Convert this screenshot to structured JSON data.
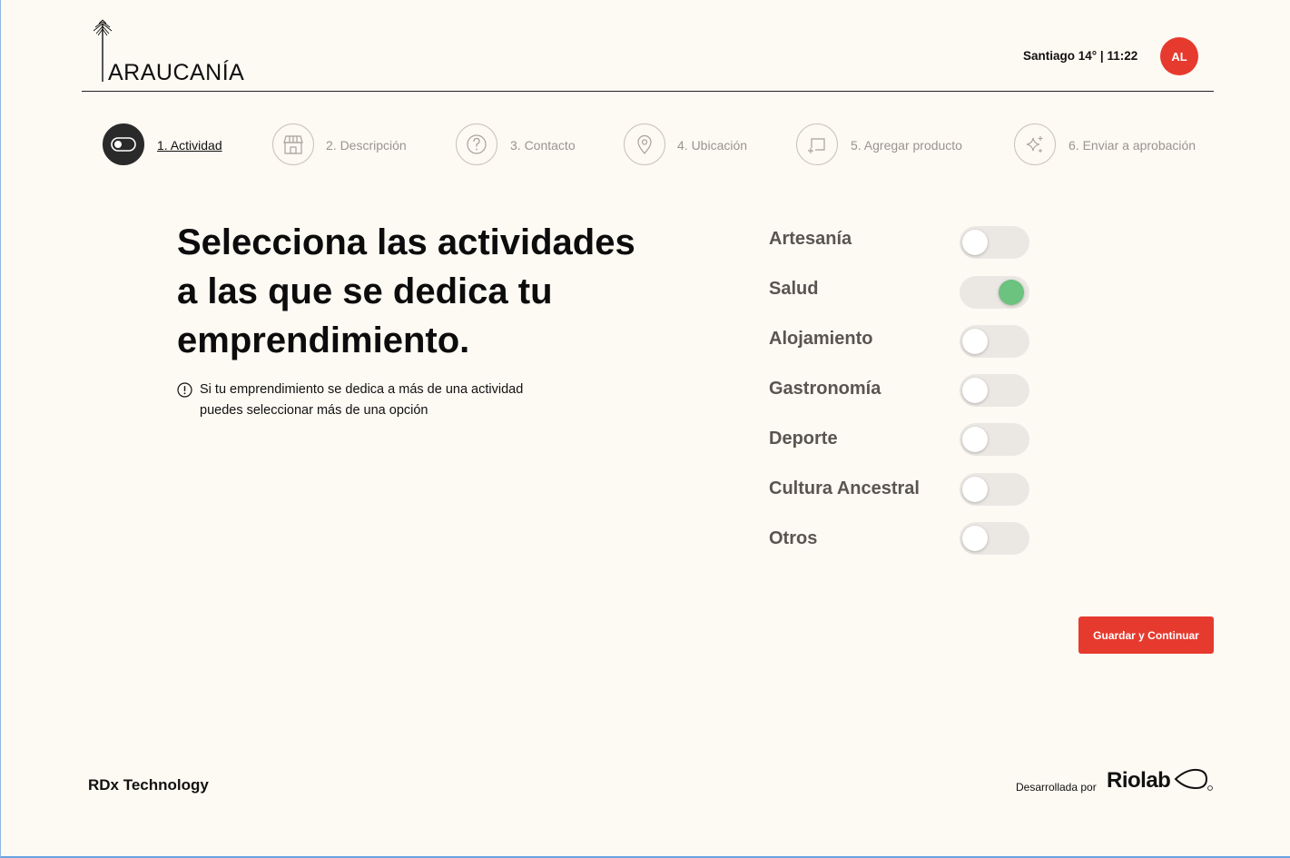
{
  "header": {
    "brand": "ARAUCANÍA",
    "weather": "Santiago 14° | 11:22",
    "avatar_initials": "AL"
  },
  "steps": [
    {
      "label": "1. Actividad",
      "icon": "toggle-icon",
      "active": true
    },
    {
      "label": "2. Descripción",
      "icon": "store-icon",
      "active": false
    },
    {
      "label": "3. Contacto",
      "icon": "question-icon",
      "active": false
    },
    {
      "label": "4. Ubicación",
      "icon": "location-pin-icon",
      "active": false
    },
    {
      "label": "5. Agregar producto",
      "icon": "add-frame-icon",
      "active": false
    },
    {
      "label": "6. Enviar a aprobación",
      "icon": "sparkles-icon",
      "active": false
    }
  ],
  "main": {
    "title": "Selecciona las actividades\na las que se dedica tu\nemprendimiento.",
    "note_icon": "exclamation-circle-icon",
    "note": "Si tu emprendimiento se dedica a más de una actividad puedes seleccionar más de una opción"
  },
  "activities": [
    {
      "label": "Artesanía",
      "checked": false
    },
    {
      "label": "Salud",
      "checked": true
    },
    {
      "label": "Alojamiento",
      "checked": false
    },
    {
      "label": "Gastronomía",
      "checked": false
    },
    {
      "label": "Deporte",
      "checked": false
    },
    {
      "label": "Cultura Ancestral",
      "checked": false
    },
    {
      "label": "Otros",
      "checked": false
    }
  ],
  "actions": {
    "save_label": "Guardar y Continuar"
  },
  "footer": {
    "company": "RDx Technology",
    "developed_by": "Desarrollada por",
    "developer": "Riolab"
  },
  "colors": {
    "accent": "#e63a2e",
    "toggle_on": "#6cc27f",
    "background": "#fdf9f3"
  }
}
